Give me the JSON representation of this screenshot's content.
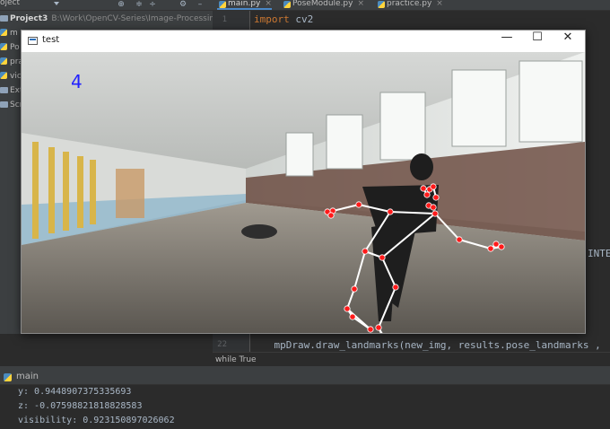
{
  "ide": {
    "project_dropdown": "oject",
    "tabs": [
      {
        "label": "main.py",
        "active": true
      },
      {
        "label": "PoseModule.py",
        "active": false
      },
      {
        "label": "practice.py",
        "active": false
      }
    ],
    "project_root": "Project3",
    "project_path": "B:\\Work\\OpenCV-Series\\Image-Processing\\Pr",
    "tree_items": [
      "m",
      "Po",
      "pra",
      "vic",
      "Extern",
      "Scratc"
    ],
    "code_lines": [
      {
        "no": "1",
        "keyword": "import",
        "rest": " cv2"
      },
      {
        "no": "22",
        "keyword": "",
        "rest": "    mpDraw.draw_landmarks(new_img, results.pose_landmarks ,"
      }
    ],
    "right_fragment": "INTE",
    "breadcrumb": "while True",
    "run_tab": "main",
    "console_lines": [
      "y: 0.9448907375335693",
      "z: -0.07598821818828583",
      "visibility: 0.923150897026062"
    ]
  },
  "cv_window": {
    "title": "test",
    "fps_text": "4",
    "controls": {
      "minimize": "—",
      "maximize": "☐",
      "close": "✕"
    }
  },
  "colors": {
    "ide_bg": "#2b2b2b",
    "panel_bg": "#3c3f41",
    "keyword": "#cc7832",
    "code_text": "#a9b7c6",
    "landmark": "#ff1a1a",
    "connection": "#ffffff",
    "fps": "#2222ff"
  },
  "icons": [
    "python-file-icon",
    "folder-icon",
    "window-app-icon",
    "minimize-icon",
    "maximize-icon",
    "close-icon"
  ]
}
